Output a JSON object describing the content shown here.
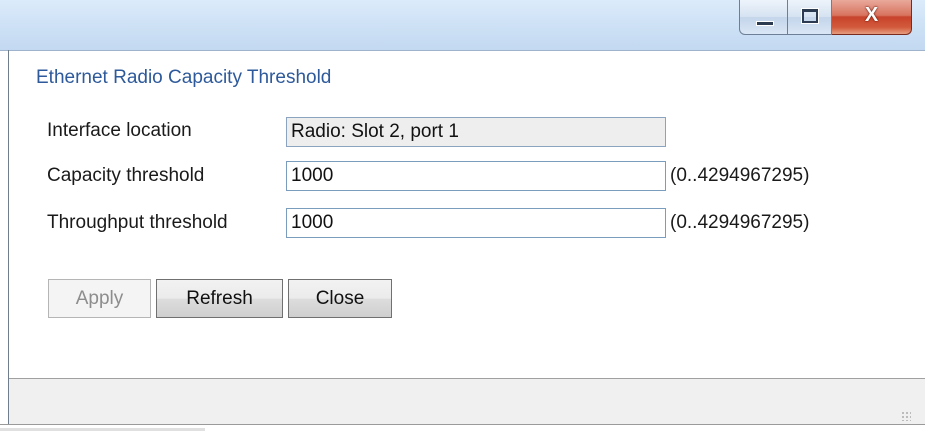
{
  "window": {
    "caption_buttons": {
      "minimize_icon": "minimize-icon",
      "maximize_icon": "maximize-icon",
      "close_glyph": "X"
    }
  },
  "dialog": {
    "title": "Ethernet Radio Capacity Threshold",
    "fields": {
      "interface_location": {
        "label": "Interface location",
        "value": "Radio: Slot 2, port 1"
      },
      "capacity_threshold": {
        "label": "Capacity threshold",
        "value": "1000",
        "range": "(0..4294967295)"
      },
      "throughput_threshold": {
        "label": "Throughput threshold",
        "value": "1000",
        "range": "(0..4294967295)"
      }
    },
    "buttons": {
      "apply": "Apply",
      "refresh": "Refresh",
      "close": "Close"
    }
  },
  "colors": {
    "title_text": "#2e5a9b",
    "close_button": "#c8432b",
    "field_border": "#7a9cbd"
  }
}
